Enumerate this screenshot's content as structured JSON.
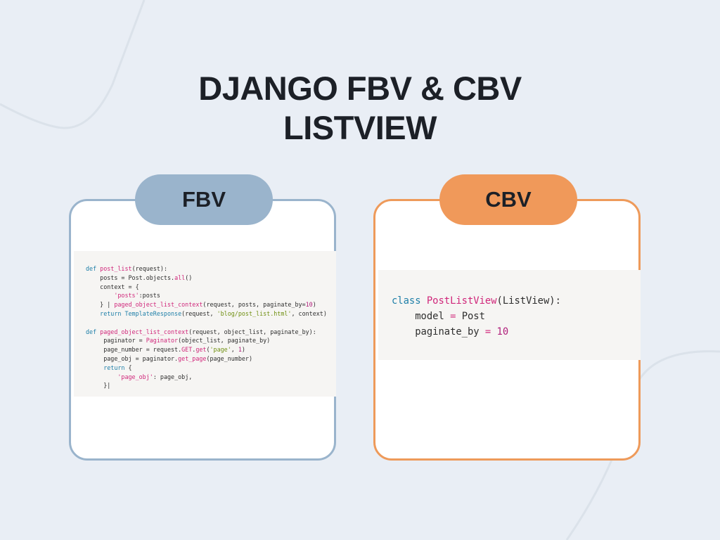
{
  "title": {
    "line1": "DJANGO FBV & CBV",
    "line2": "LISTVIEW"
  },
  "fbv": {
    "label": "FBV",
    "code": {
      "l1_def": "def ",
      "l1_fn": "post_list",
      "l1_rest": "(request):",
      "l2_a": "    posts = Post.objects.",
      "l2_fn": "all",
      "l2_b": "()",
      "l3": "    context = {",
      "l4_str": "        'posts'",
      "l4_rest": ":posts",
      "l5_a": "    } | ",
      "l5_fn": "paged_object_list_context",
      "l5_b": "(request, posts, paginate_by=",
      "l5_num": "10",
      "l5_c": ")",
      "l6_kw": "    return ",
      "l6_fn": "TemplateResponse",
      "l6_a": "(request, ",
      "l6_str": "'blog/post_list.html'",
      "l6_b": ", context)",
      "l8_def": "def ",
      "l8_fn": "paged_object_list_context",
      "l8_rest": "(request, object_list, paginate_by):",
      "l9_a": "     paginator = ",
      "l9_fn": "Paginator",
      "l9_b": "(object_list, paginate_by)",
      "l10_a": "     page_number = request.",
      "l10_kw": "GET",
      "l10_b": ".",
      "l10_fn": "get",
      "l10_c": "(",
      "l10_str": "'page'",
      "l10_d": ", ",
      "l10_num": "1",
      "l10_e": ")",
      "l11_a": "     page_obj = paginator.",
      "l11_fn": "get_page",
      "l11_b": "(page_number)",
      "l12_kw": "     return ",
      "l12_b": "{",
      "l13_str": "         'page_obj'",
      "l13_rest": ": page_obj,",
      "l14": "     }|"
    }
  },
  "cbv": {
    "label": "CBV",
    "code": {
      "l1_kw": "class ",
      "l1_fn": "PostListView",
      "l1_rest": "(ListView):",
      "l2_a": "    model ",
      "l2_op": "=",
      "l2_b": " Post",
      "l3_a": "    paginate_by ",
      "l3_op": "=",
      "l3_sp": " ",
      "l3_num": "10"
    }
  },
  "colors": {
    "background": "#e9eef5",
    "fbv_accent": "#9ab4cc",
    "cbv_accent": "#f0995a",
    "code_bg": "#f6f5f3",
    "title": "#1c2027"
  }
}
